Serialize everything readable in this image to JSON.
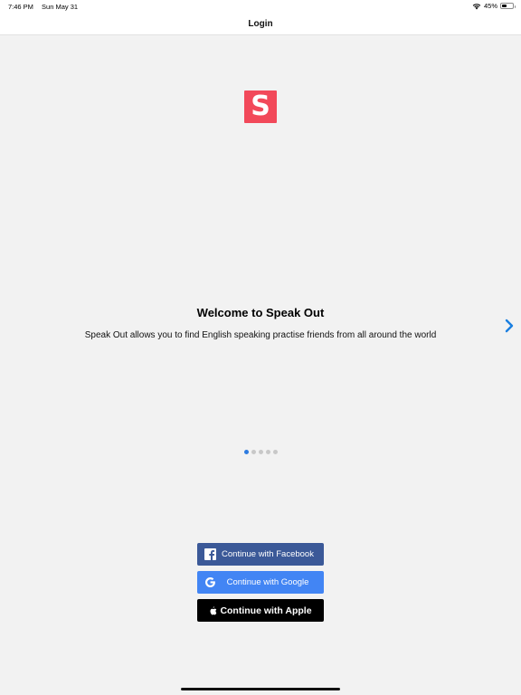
{
  "status_bar": {
    "time": "7:46 PM",
    "date": "Sun May 31",
    "battery_percent": "45%",
    "battery_level": 0.45,
    "wifi_icon": "wifi-icon"
  },
  "nav": {
    "title": "Login"
  },
  "logo": {
    "letter": "S",
    "color": "#f2495a"
  },
  "onboarding": {
    "title": "Welcome to Speak Out",
    "description": "Speak Out allows you to find English speaking practise friends from all around the world",
    "page_count": 5,
    "current_page": 1,
    "next_icon": "chevron-right-icon"
  },
  "buttons": {
    "facebook": {
      "label": "Continue with Facebook",
      "color": "#3b5998",
      "icon": "facebook-icon"
    },
    "google": {
      "label": "Continue with Google",
      "color": "#4285f4",
      "icon": "google-icon"
    },
    "apple": {
      "label": "Continue with Apple",
      "color": "#000000",
      "icon": "apple-icon"
    }
  }
}
